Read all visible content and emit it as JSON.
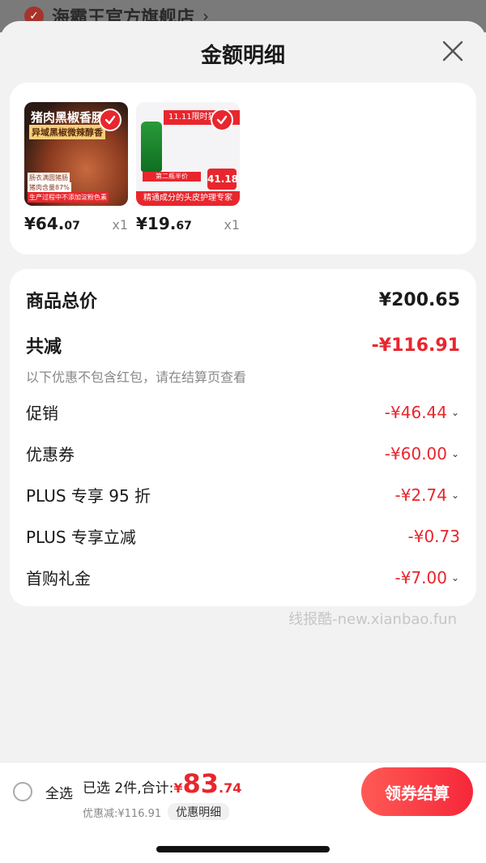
{
  "store": {
    "name": "海霸王官方旗舰店",
    "chevron": "›"
  },
  "sheet": {
    "title": "金额明细"
  },
  "products": [
    {
      "price_int": "¥64.",
      "price_dec": "07",
      "qty": "x1",
      "thumb_lines": [
        "猪肉黑椒香肠",
        "异域黑椒微辣醇香",
        "肠衣满圆猪肠",
        "猪肉含量87%",
        "生产过程中不添加淀粉色素"
      ]
    },
    {
      "price_int": "¥19.",
      "price_dec": "67",
      "qty": "x1",
      "thumb_lines": [
        "11.11限时狂欢",
        "第二瓶半价",
        "41.18",
        "精通成分的头皮护理专家"
      ]
    }
  ],
  "breakdown": {
    "goods_total_label": "商品总价",
    "goods_total_value": "¥200.65",
    "total_reduce_label": "共减",
    "total_reduce_value": "-¥116.91",
    "note": "以下优惠不包含红包，请在结算页查看",
    "items": [
      {
        "label": "促销",
        "value": "-¥46.44"
      },
      {
        "label": "优惠券",
        "value": "-¥60.00"
      },
      {
        "label": "PLUS 专享 95 折",
        "value": "-¥2.74"
      },
      {
        "label": "PLUS 专享立减",
        "value": "-¥0.73"
      },
      {
        "label": "首购礼金",
        "value": "-¥7.00"
      }
    ]
  },
  "watermark": "线报酷-new.xianbao.fun",
  "footer": {
    "select_all": "全选",
    "selected_text": "已选 2件,合计:",
    "total_yen": "¥",
    "total_int": "83",
    "total_dec": ".74",
    "discount_text": "优惠减:¥116.91",
    "detail_link": "优惠明细",
    "checkout": "领券结算"
  },
  "colors": {
    "accent": "#e8262d",
    "background": "#f2f2f2"
  }
}
